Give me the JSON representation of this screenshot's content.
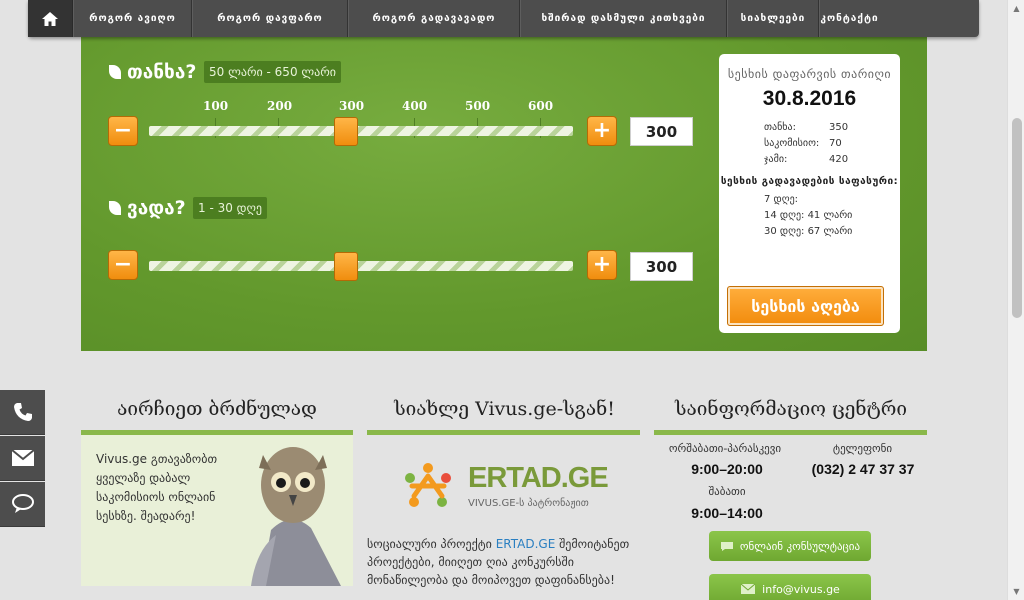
{
  "nav": {
    "home_icon": "home-icon",
    "items": [
      "როგორ ავიღო",
      "როგორ დავფარო",
      "როგორ გადავავადო",
      "ხშირად დასმული კითხვები",
      "სიახლეები",
      "კონტაქტი"
    ]
  },
  "calculator": {
    "amount_title": "თანხა?",
    "amount_range": "50 ლარი - 650 ლარი",
    "ticks": [
      "100",
      "200",
      "300",
      "400",
      "500",
      "600"
    ],
    "amount_value": "300",
    "term_title": "ვადა?",
    "term_range": "1 - 30 დღე",
    "term_value": "300",
    "minus": "−",
    "plus": "+"
  },
  "summary": {
    "title": "სესხის დაფარვის თარიღი",
    "date": "30.8.2016",
    "rows": [
      {
        "label": "თანხა:",
        "value": "350"
      },
      {
        "label": "საკომისიო:",
        "value": "70"
      },
      {
        "label": "ჯამი:",
        "value": "420"
      }
    ],
    "schedule_title": "სესხის გადავადების საფასური:",
    "schedule": [
      "7 დღე:",
      "14 დღე: 41 ლარი",
      "30 დღე: 67 ლარი"
    ],
    "button": "სესხის აღება"
  },
  "sections": {
    "wise": {
      "title": "აირჩიეთ ბრძნულად",
      "text": "Vivus.ge გთავაზობთ ყველაზე დაბალ საკომისიოს ონლაინ სესხზე. შეადარე!"
    },
    "news": {
      "title": "სიახლე Vivus.ge-სგან!",
      "logo_text": "ERTAD.GE",
      "logo_sub": "VIVUS.GE-ს პატრონაჟით",
      "text_before": "სოციალური პროექტი ",
      "link": "ERTAD.GE",
      "text_after": " შემოიტანეთ პროექტები, მიიღეთ ღია კონკურსში მონაწილეობა და მოიპოვეთ დაფინანსება!"
    },
    "info": {
      "title": "საინფორმაციო ცენტრი",
      "weekdays_label": "ორშაბათი-პარასკევი",
      "weekdays_hours": "9:00–20:00",
      "phone_label": "ტელეფონი",
      "phone": "(032) 2 47 37 37",
      "saturday_label": "შაბათი",
      "saturday_hours": "9:00–14:00",
      "chat_button": "ონლაინ კონსულტაცია",
      "email_button": "info@vivus.ge"
    }
  },
  "side_tabs": [
    "phone-icon",
    "mail-icon",
    "chat-icon"
  ],
  "colors": {
    "green": "#62982c",
    "orange": "#f28b0c",
    "nav": "#4d4d4d"
  }
}
